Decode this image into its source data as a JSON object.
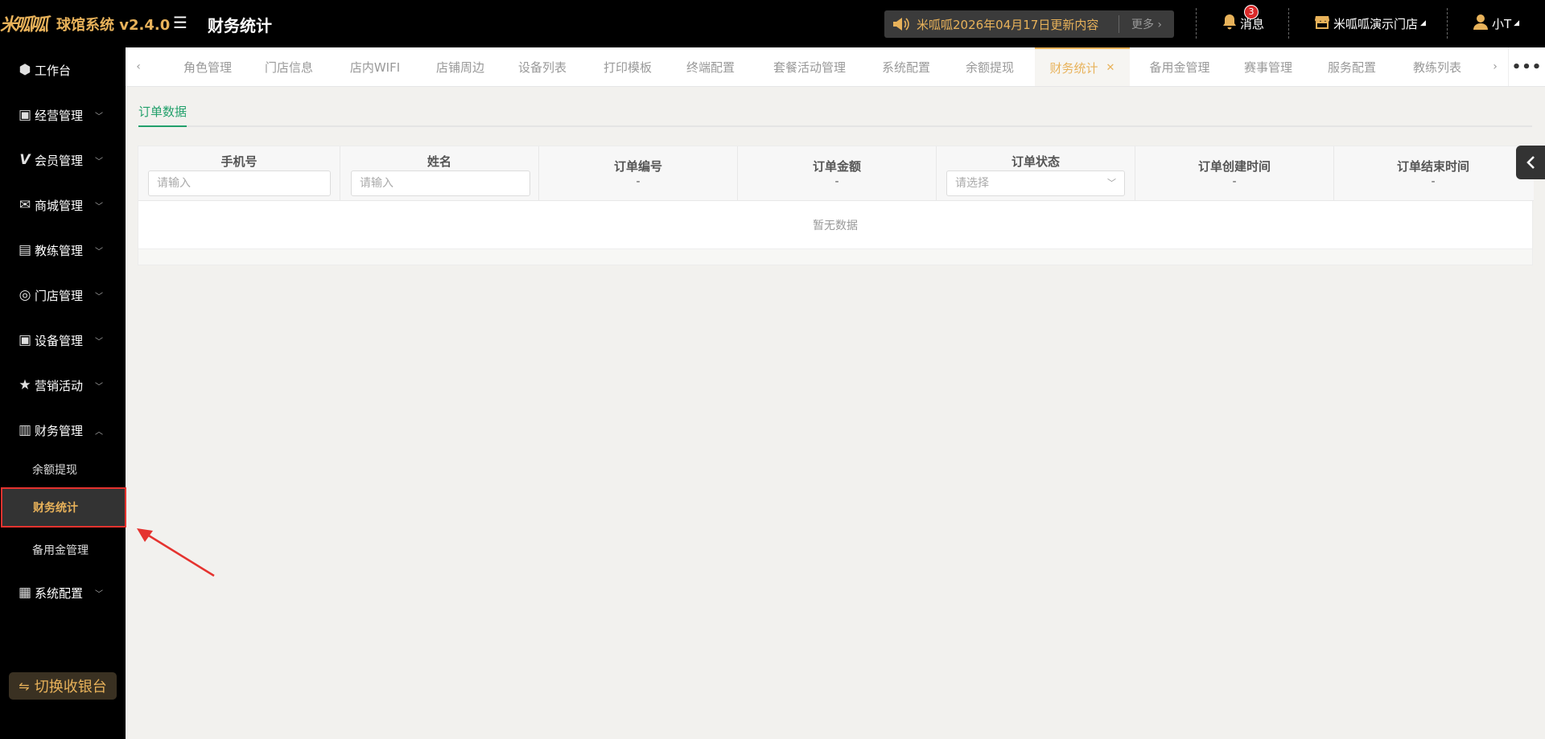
{
  "header": {
    "logo_text": "米呱呱",
    "app_name": "球馆系统 v2.4.0",
    "page_title": "财务统计",
    "notice": {
      "text": "米呱呱2026年04月17日更新内容",
      "more": "更多"
    },
    "messages": {
      "label": "消息",
      "count": "3"
    },
    "store": {
      "label": "米呱呱演示门店"
    },
    "user": {
      "label": "小T"
    }
  },
  "sidebar": {
    "items": [
      {
        "label": "工作台",
        "icon": "cube-icon"
      },
      {
        "label": "经营管理",
        "icon": "chart-badge-icon"
      },
      {
        "label": "会员管理",
        "icon": "v-icon"
      },
      {
        "label": "商城管理",
        "icon": "mail-icon"
      },
      {
        "label": "教练管理",
        "icon": "coach-icon"
      },
      {
        "label": "门店管理",
        "icon": "coins-icon"
      },
      {
        "label": "设备管理",
        "icon": "device-icon"
      },
      {
        "label": "营销活动",
        "icon": "star-icon"
      },
      {
        "label": "财务管理",
        "icon": "finance-chart-icon"
      },
      {
        "label": "系统配置",
        "icon": "grid-icon"
      }
    ],
    "finance_sub": [
      {
        "label": "余额提现"
      },
      {
        "label": "财务统计"
      },
      {
        "label": "备用金管理"
      }
    ],
    "switch_button": "切换收银台"
  },
  "tabs": [
    {
      "label": "角色管理"
    },
    {
      "label": "门店信息"
    },
    {
      "label": "店内WIFI"
    },
    {
      "label": "店铺周边"
    },
    {
      "label": "设备列表"
    },
    {
      "label": "打印模板"
    },
    {
      "label": "终端配置"
    },
    {
      "label": "套餐活动管理"
    },
    {
      "label": "系统配置"
    },
    {
      "label": "余额提现"
    },
    {
      "label": "财务统计"
    },
    {
      "label": "备用金管理"
    },
    {
      "label": "赛事管理"
    },
    {
      "label": "服务配置"
    },
    {
      "label": "教练列表"
    }
  ],
  "content": {
    "subtab": "订单数据",
    "columns": {
      "phone": {
        "label": "手机号",
        "placeholder": "请输入"
      },
      "name": {
        "label": "姓名",
        "placeholder": "请输入"
      },
      "order_no": {
        "label": "订单编号",
        "value": "-"
      },
      "amount": {
        "label": "订单金额",
        "value": "-"
      },
      "status": {
        "label": "订单状态",
        "placeholder": "请选择"
      },
      "created": {
        "label": "订单创建时间",
        "value": "-"
      },
      "ended": {
        "label": "订单结束时间",
        "value": "-"
      }
    },
    "empty_text": "暂无数据"
  },
  "colors": {
    "accent": "#e8b25a",
    "green": "#22a06b",
    "annotation": "#e5332f"
  }
}
